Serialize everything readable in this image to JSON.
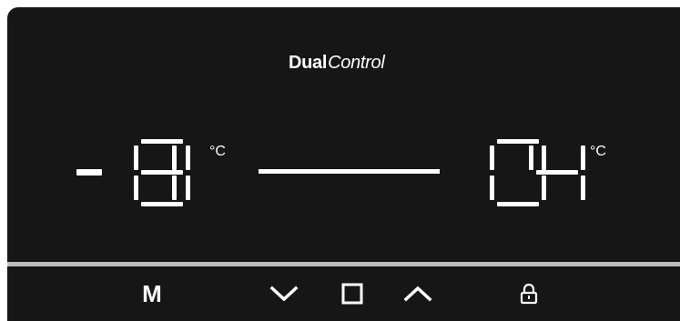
{
  "brand": {
    "bold": "Dual",
    "italic": "Control"
  },
  "freezer": {
    "sign": "-",
    "digits": [
      "1",
      "8"
    ],
    "unit": "°C"
  },
  "fridge": {
    "digits": [
      "0",
      "4"
    ],
    "unit": "°C"
  },
  "controls": {
    "mode_label": "M",
    "down_icon": "chevron-down-icon",
    "stop_icon": "square-icon",
    "up_icon": "chevron-up-icon",
    "lock_icon": "lock-icon"
  },
  "colors": {
    "panel": "#161616",
    "display": "#ffffff",
    "separator": "#bdbdbd"
  }
}
